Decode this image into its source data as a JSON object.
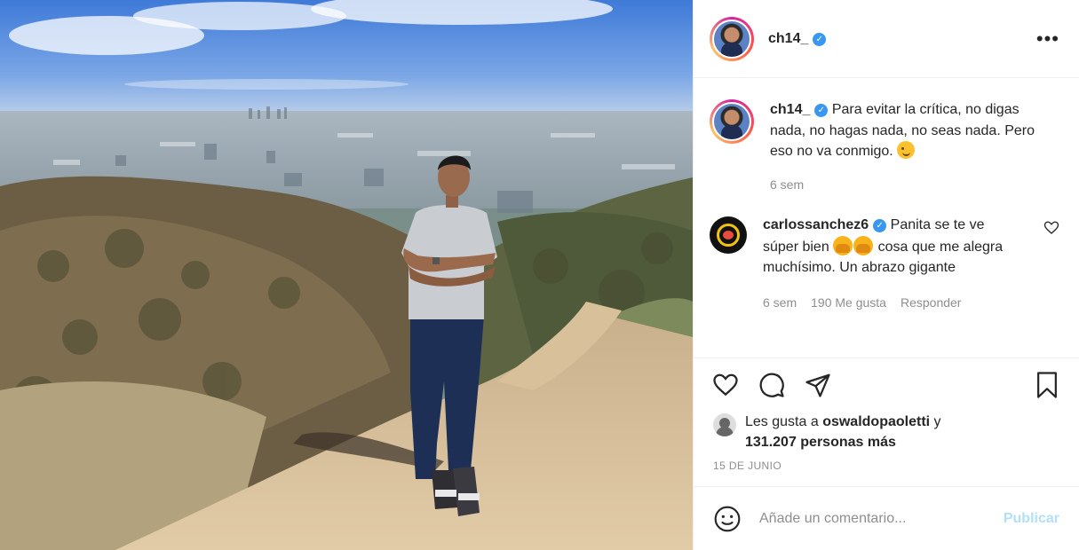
{
  "post": {
    "username": "ch14_",
    "more_icon": "more-options-icon",
    "caption": {
      "username": "ch14_",
      "text": "Para evitar la crítica, no digas nada, no hagas nada, no seas nada. Pero eso no va conmigo.",
      "emoji": "wink-emoji",
      "time": "6 sem"
    },
    "comments": [
      {
        "username": "carlossanchez6",
        "text_a": "Panita se te ve súper bien",
        "text_b": "cosa que me alegra muchísimo. Un abrazo gigante",
        "emoji": "raising-hands-emoji",
        "time": "6 sem",
        "likes": "190 Me gusta",
        "reply": "Responder"
      }
    ],
    "actions": {
      "like_icon": "heart-icon",
      "comment_icon": "comment-icon",
      "share_icon": "send-icon",
      "save_icon": "bookmark-icon"
    },
    "likes": {
      "prefix": "Les gusta a",
      "user": "oswaldopaoletti",
      "joiner": "y",
      "count": "131.207 personas más"
    },
    "date": "15 DE JUNIO",
    "add_comment": {
      "placeholder": "Añade un comentario...",
      "publish": "Publicar"
    },
    "colors": {
      "verified": "#3897f0",
      "publish_disabled": "#b2dffc",
      "muted": "#8e8e8e"
    }
  }
}
